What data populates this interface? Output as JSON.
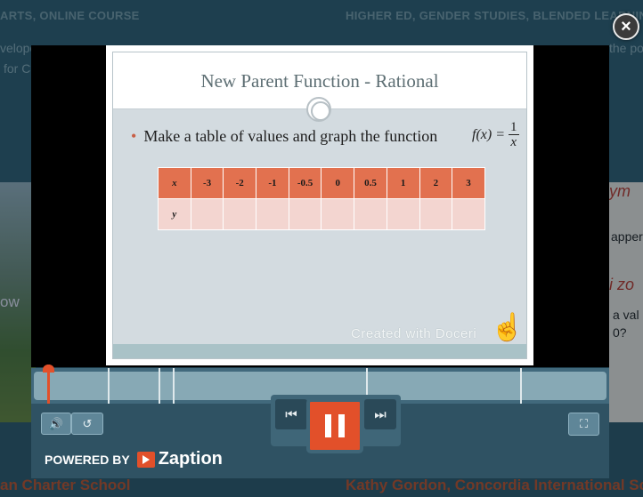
{
  "background": {
    "left_meta": "ARTS, ONLINE COURSE",
    "right_meta": "HIGHER ED, GENDER STUDIES, BLENDED LEARNING",
    "left_snippet_1": "velope",
    "left_snippet_2": "for C",
    "right_snippet": "the po",
    "left_word": "ow",
    "right_word_1": "apper",
    "right_word_2": "a val",
    "right_word_3": "0?",
    "left_title": "an Charter School",
    "right_title": "Kathy Gordon, Concordia International Sc"
  },
  "overlay": {
    "close_glyph": "×"
  },
  "slide": {
    "title": "New Parent Function - Rational",
    "bullet": "Make a table of values and graph the function",
    "formula_lhs": "f(x) =",
    "formula_num": "1",
    "formula_den": "x",
    "table": {
      "x_label": "x",
      "y_label": "y",
      "x_values": [
        "-3",
        "-2",
        "-1",
        "-0.5",
        "0",
        "0.5",
        "1",
        "2",
        "3"
      ]
    },
    "watermark": "Created with Doceri"
  },
  "timeline": {
    "markers": 6
  },
  "controls": {
    "volume_glyph": "🔊",
    "replay_glyph": "↺",
    "prev_glyph": "⏮",
    "next_glyph": "⏭",
    "fullscreen_glyph": "⛶",
    "powered_by": "POWERED BY",
    "brand": "Zaption"
  },
  "colors": {
    "accent": "#e2502a",
    "player_bar": "#2f5263"
  }
}
